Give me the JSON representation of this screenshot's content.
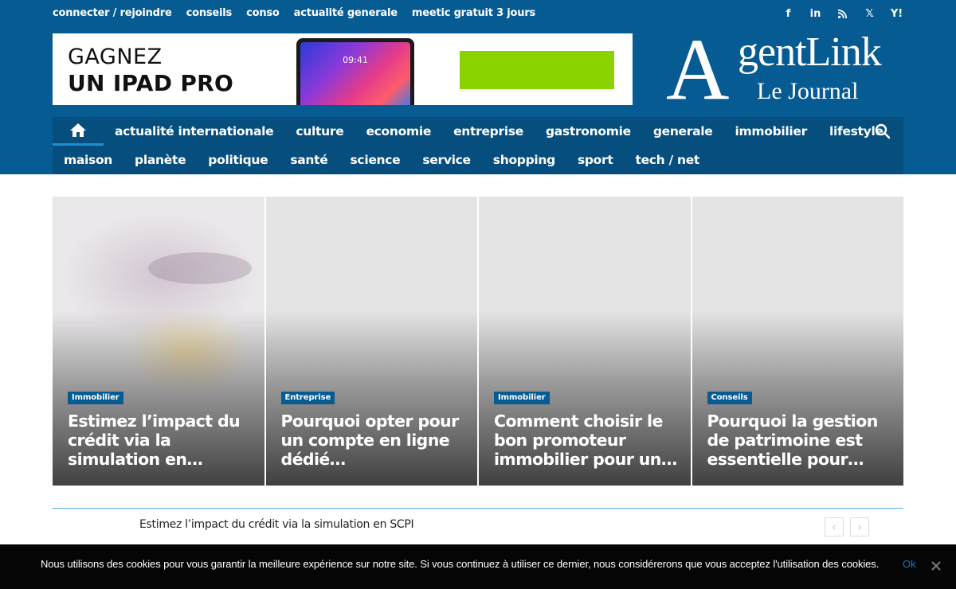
{
  "topbar": {
    "links": [
      "connecter / rejoindre",
      "conseils",
      "conso",
      "actualité generale",
      "meetic gratuit 3 jours"
    ],
    "social_icons": [
      "facebook-icon",
      "linkedin-icon",
      "rss-icon",
      "x-icon",
      "yahoo-icon"
    ],
    "social_glyphs": [
      "f",
      "in",
      "",
      "𝕏",
      "Y!"
    ]
  },
  "banner": {
    "line1": "GAGNEZ",
    "line2": "UN IPAD PRO",
    "device_time": "09:41",
    "cta_color": "#8ad300"
  },
  "logo": {
    "big_letter": "A",
    "rest": "gentLink",
    "subtitle": "Le Journal"
  },
  "nav": {
    "row1": [
      "actualité internationale",
      "culture",
      "economie",
      "entreprise",
      "gastronomie",
      "generale",
      "immobilier",
      "lifestyle"
    ],
    "row2": [
      "maison",
      "planète",
      "politique",
      "santé",
      "science",
      "service",
      "shopping",
      "sport",
      "tech / net"
    ]
  },
  "featured": [
    {
      "tag": "Immobilier",
      "title": "Estimez l’impact du crédit via la simulation en…"
    },
    {
      "tag": "Entreprise",
      "title": "Pourquoi opter pour un compte en ligne dédié…"
    },
    {
      "tag": "Immobilier",
      "title": "Comment choisir le bon promoteur immobilier pour un…"
    },
    {
      "tag": "Conseils",
      "title": "Pourquoi la gestion de patrimoine est essentielle pour…"
    }
  ],
  "ticker": {
    "text": "Estimez l’impact du crédit via la simulation en SCPI",
    "prev": "‹",
    "next": "›"
  },
  "cookie": {
    "text": "Nous utilisons des cookies pour vous garantir la meilleure expérience sur notre site. Si vous continuez à utiliser ce dernier, nous considérerons que vous acceptez l'utilisation des cookies.",
    "ok": "Ok"
  },
  "colors": {
    "header_bg": "#075b93",
    "nav_bg": "#064e7e",
    "tag_bg": "#075b93",
    "accent": "#4db2ec",
    "cookie_bg": "#050505"
  }
}
